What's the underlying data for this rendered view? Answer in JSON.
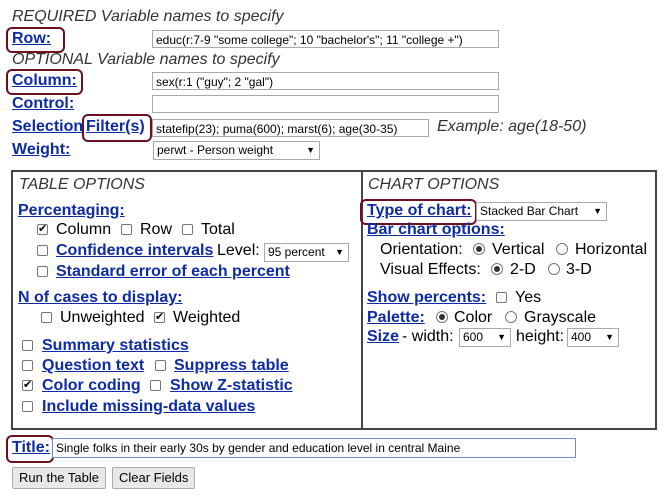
{
  "required_header": "REQUIRED Variable names to specify",
  "optional_header": "OPTIONAL Variable names to specify",
  "row": {
    "label": "Row:",
    "value": "educ(r:7-9 \"some college\"; 10 \"bachelor's\"; 11 \"college +\")"
  },
  "column": {
    "label": "Column:",
    "value": "sex(r:1 (\"guy\"; 2 \"gal\")"
  },
  "control": {
    "label": "Control:",
    "value": ""
  },
  "selection": {
    "label1": "Selection",
    "label2": "Filter(s)",
    "value": "statefip(23); puma(600); marst(6); age(30-35)",
    "example": "Example: age(18-50)"
  },
  "weight": {
    "label": "Weight:",
    "value": "perwt - Person weight"
  },
  "table_options": {
    "title": "TABLE OPTIONS",
    "percentaging": "Percentaging:",
    "column": "Column",
    "row": "Row",
    "total": "Total",
    "confidence": "Confidence intervals",
    "level": "Level:",
    "level_value": "95 percent",
    "std_error": "Standard error of each percent",
    "n_cases": "N of cases to display:",
    "unweighted": "Unweighted",
    "weighted": "Weighted",
    "summary": "Summary statistics",
    "question": "Question text",
    "suppress": "Suppress table",
    "color_coding": "Color coding",
    "zstat": "Show Z-statistic",
    "missing": "Include missing-data values"
  },
  "chart_options": {
    "title": "CHART OPTIONS",
    "type_label": "Type of chart:",
    "type_value": "Stacked Bar Chart",
    "bar_options": "Bar chart options:",
    "orientation": "Orientation:",
    "vertical": "Vertical",
    "horizontal": "Horizontal",
    "visual": "Visual Effects:",
    "twod": "2-D",
    "threed": "3-D",
    "show_percents": "Show percents:",
    "yes": "Yes",
    "palette": "Palette:",
    "color": "Color",
    "grayscale": "Grayscale",
    "size": "Size",
    "width_label": "- width:",
    "width_value": "600",
    "height_label": "height:",
    "height_value": "400"
  },
  "title_field": {
    "label": "Title:",
    "value": "Single folks in their early 30s by gender and education level in central Maine"
  },
  "buttons": {
    "run": "Run the Table",
    "clear": "Clear Fields"
  }
}
